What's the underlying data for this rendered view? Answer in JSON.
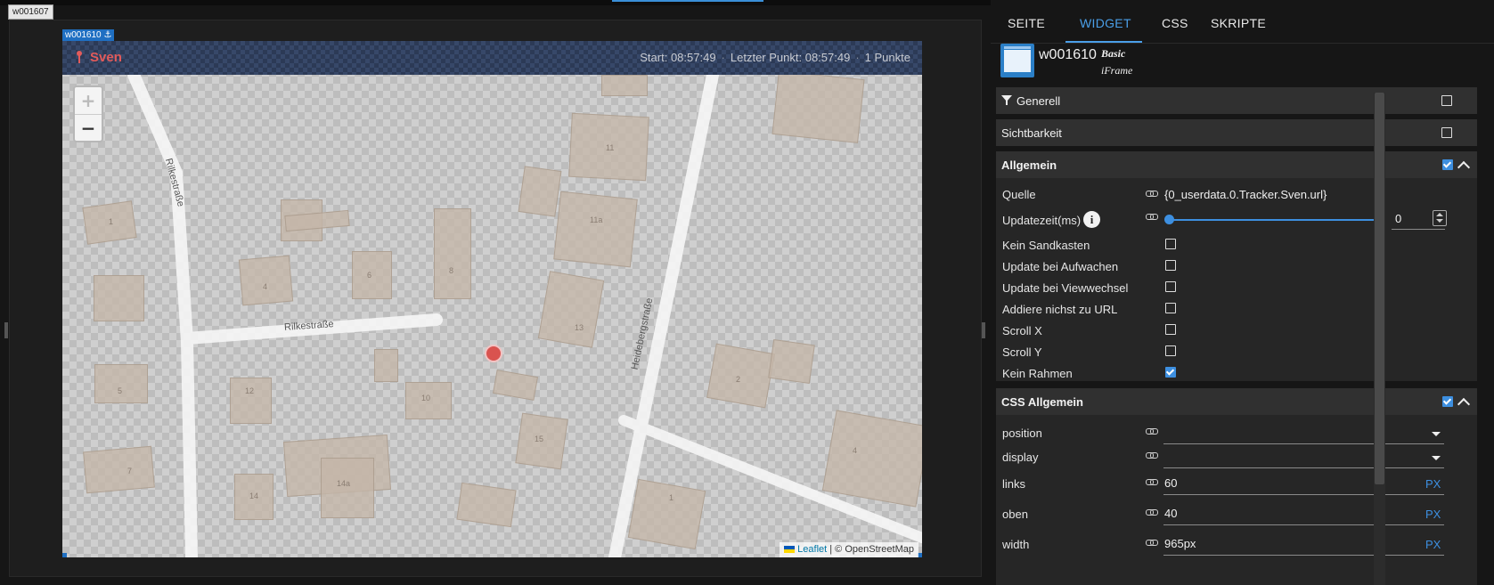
{
  "editor": {
    "outer_widget_id": "w001607",
    "widget_tag": "w001610",
    "widget_tag_icon": "anchor-icon",
    "map": {
      "name": "Sven",
      "start_label": "Start: 08:57:49",
      "last_point_label": "Letzter Punkt: 08:57:49",
      "points_label": "1 Punkte",
      "zoom_in": "+",
      "zoom_out": "−",
      "attribution_link": "Leaflet",
      "attribution_text": "| © OpenStreetMap",
      "streets": [
        "Rilkestraße",
        "Rilkestraße",
        "Heidebergstraße"
      ],
      "house_numbers": [
        "1",
        "4",
        "6",
        "8",
        "11",
        "11a",
        "13",
        "12",
        "10",
        "5",
        "7",
        "14",
        "14a",
        "15",
        "2",
        "4",
        "1"
      ],
      "marker_color": "#d9534f"
    }
  },
  "panel": {
    "tabs": [
      "SEITE",
      "WIDGET",
      "CSS",
      "SKRIPTE"
    ],
    "active_tab": "WIDGET",
    "widget": {
      "id": "w001610",
      "set": "Basic",
      "type": "iFrame",
      "icon": "iframe-widget-icon"
    },
    "sections": {
      "generell": {
        "title": "Generell",
        "icon": "filter-icon",
        "checked": false
      },
      "sichtbarkeit": {
        "title": "Sichtbarkeit",
        "checked": false
      },
      "allgemein": {
        "title": "Allgemein",
        "checked": true,
        "quelle_label": "Quelle",
        "quelle_value": "{0_userdata.0.Tracker.Sven.url}",
        "update_label": "Updatezeit(ms)",
        "update_value": "0",
        "update_level": 0,
        "checkboxes": [
          {
            "label": "Kein Sandkasten",
            "checked": false
          },
          {
            "label": "Update bei Aufwachen",
            "checked": false
          },
          {
            "label": "Update bei Viewwechsel",
            "checked": false
          },
          {
            "label": "Addiere nichst zu URL",
            "checked": false
          },
          {
            "label": "Scroll X",
            "checked": false
          },
          {
            "label": "Scroll Y",
            "checked": false
          },
          {
            "label": "Kein Rahmen",
            "checked": true
          }
        ]
      },
      "css_allgemein": {
        "title": "CSS Allgemein",
        "checked": true,
        "fields": [
          {
            "label": "position",
            "value": "",
            "unit": ""
          },
          {
            "label": "display",
            "value": "",
            "unit": ""
          },
          {
            "label": "links",
            "value": "60",
            "unit": "PX"
          },
          {
            "label": "oben",
            "value": "40",
            "unit": "PX"
          },
          {
            "label": "width",
            "value": "965px",
            "unit": "PX"
          }
        ]
      }
    },
    "accent_color": "#3d8fe0"
  }
}
